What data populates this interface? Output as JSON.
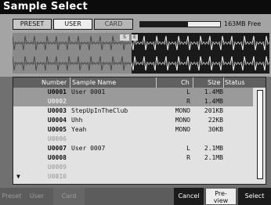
{
  "window": {
    "title": "Sample Select"
  },
  "source_tabs": [
    {
      "label": "PRESET"
    },
    {
      "label": "USER"
    },
    {
      "label": "CARD"
    }
  ],
  "memory": {
    "free_text": "163MB Free",
    "used_fraction": 0.6
  },
  "waveform": {
    "marker_a": "S",
    "marker_b": "E"
  },
  "table": {
    "headers": {
      "number": "Number",
      "name": "Sample Name",
      "ch": "Ch",
      "size": "Size",
      "status": "Status"
    },
    "rows": [
      {
        "number": "U0001",
        "name": "User 0001",
        "ch": "L",
        "size": "1.4MB",
        "status": ""
      },
      {
        "number": "U0002",
        "name": "",
        "ch": "R",
        "size": "1.4MB",
        "status": ""
      },
      {
        "number": "U0003",
        "name": "StepUpInTheClub",
        "ch": "MONO",
        "size": "201KB",
        "status": ""
      },
      {
        "number": "U0004",
        "name": "Uhh",
        "ch": "MONO",
        "size": "22KB",
        "status": ""
      },
      {
        "number": "U0005",
        "name": "Yeah",
        "ch": "MONO",
        "size": "30KB",
        "status": ""
      },
      {
        "number": "U0006",
        "name": "",
        "ch": "",
        "size": "",
        "status": ""
      },
      {
        "number": "U0007",
        "name": "User 0007",
        "ch": "L",
        "size": "2.1MB",
        "status": ""
      },
      {
        "number": "U0008",
        "name": "",
        "ch": "R",
        "size": "2.1MB",
        "status": ""
      },
      {
        "number": "U0009",
        "name": "",
        "ch": "",
        "size": "",
        "status": ""
      },
      {
        "number": "U0010",
        "name": "",
        "ch": "",
        "size": "",
        "status": ""
      }
    ]
  },
  "bottom_buttons": {
    "preset": "Preset",
    "user": "User",
    "card": "Card",
    "cancel": "Cancel",
    "preview_line1": "Pre-",
    "preview_line2": "view",
    "select": "Select"
  }
}
